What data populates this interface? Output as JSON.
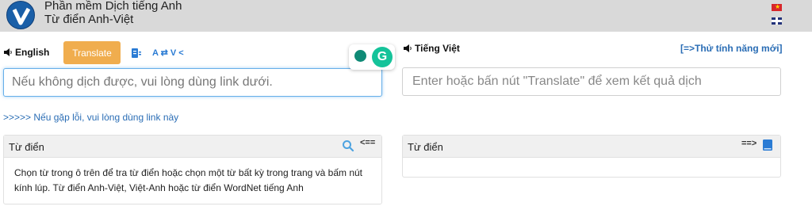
{
  "header": {
    "title_line1": "Phần mềm Dịch tiếng Anh",
    "title_line2": "Từ điển Anh-Việt",
    "logo_letter": "V"
  },
  "source": {
    "language_label": "English",
    "translate_button": "Translate",
    "swap_label": "A ⇄ V <",
    "placeholder": "Nếu không dịch được, vui lòng dùng link dưới."
  },
  "target": {
    "language_label": "Tiếng Việt",
    "try_new_link": "[=>Thử tính năng mới]",
    "placeholder": "Enter hoặc bấn nút \"Translate\" để xem kết quả dịch"
  },
  "grammarly": {
    "logo_letter": "G"
  },
  "error_link": ">>>>> Nếu gặp lỗi, vui lòng dùng link này",
  "left_dictionary": {
    "title": "Từ điển",
    "arrow": "<==",
    "body": "Chọn từ trong ô trên để tra từ điển hoặc chọn một từ bất kỳ trong trang và bấm nút kính lúp. Từ điển Anh-Việt, Việt-Anh hoặc từ điển WordNet tiếng Anh"
  },
  "right_dictionary": {
    "title": "Từ điển",
    "arrow": "==>"
  },
  "colors": {
    "header_bg": "#d9d9d9",
    "translate_button": "#f0ad4e",
    "link": "#2a6db5",
    "grammarly": "#15c39a"
  },
  "icons": [
    "logo-v-icon",
    "vietnam-flag-icon",
    "uk-flag-icon",
    "speaker-icon",
    "clear-text-icon",
    "lightbulb-icon",
    "grammarly-icon",
    "search-icon",
    "book-icon"
  ]
}
